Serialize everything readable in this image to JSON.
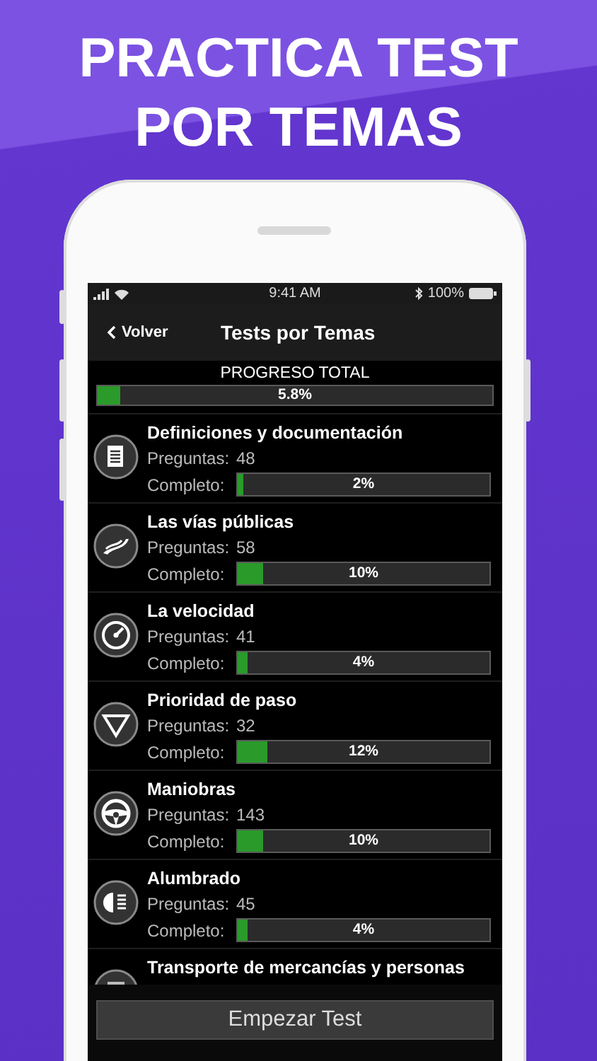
{
  "headline": [
    "PRACTICA TEST",
    "POR TEMAS"
  ],
  "status_bar": {
    "time": "9:41 AM",
    "battery": "100%"
  },
  "nav": {
    "back": "Volver",
    "title": "Tests por Temas"
  },
  "total": {
    "label": "PROGRESO TOTAL",
    "level": 0.058,
    "reading": "5.8%"
  },
  "topics": [
    {
      "title": "Definiciones y documentación",
      "questions_label": "Preguntas:",
      "questions": "48",
      "complete_label": "Completo:",
      "level": 0.02,
      "reading": "2%"
    },
    {
      "title": "Las vías públicas",
      "questions_label": "Preguntas:",
      "questions": "58",
      "complete_label": "Completo:",
      "level": 0.1,
      "reading": "10%"
    },
    {
      "title": "La velocidad",
      "questions_label": "Preguntas:",
      "questions": "41",
      "complete_label": "Completo:",
      "level": 0.04,
      "reading": "4%"
    },
    {
      "title": "Prioridad de paso",
      "questions_label": "Preguntas:",
      "questions": "32",
      "complete_label": "Completo:",
      "level": 0.12,
      "reading": "12%"
    },
    {
      "title": "Maniobras",
      "questions_label": "Preguntas:",
      "questions": "143",
      "complete_label": "Completo:",
      "level": 0.1,
      "reading": "10%"
    },
    {
      "title": "Alumbrado",
      "questions_label": "Preguntas:",
      "questions": "45",
      "complete_label": "Completo:",
      "level": 0.04,
      "reading": "4%"
    },
    {
      "title": "Transporte de mercancías y personas"
    }
  ],
  "start_button": "Empezar Test"
}
